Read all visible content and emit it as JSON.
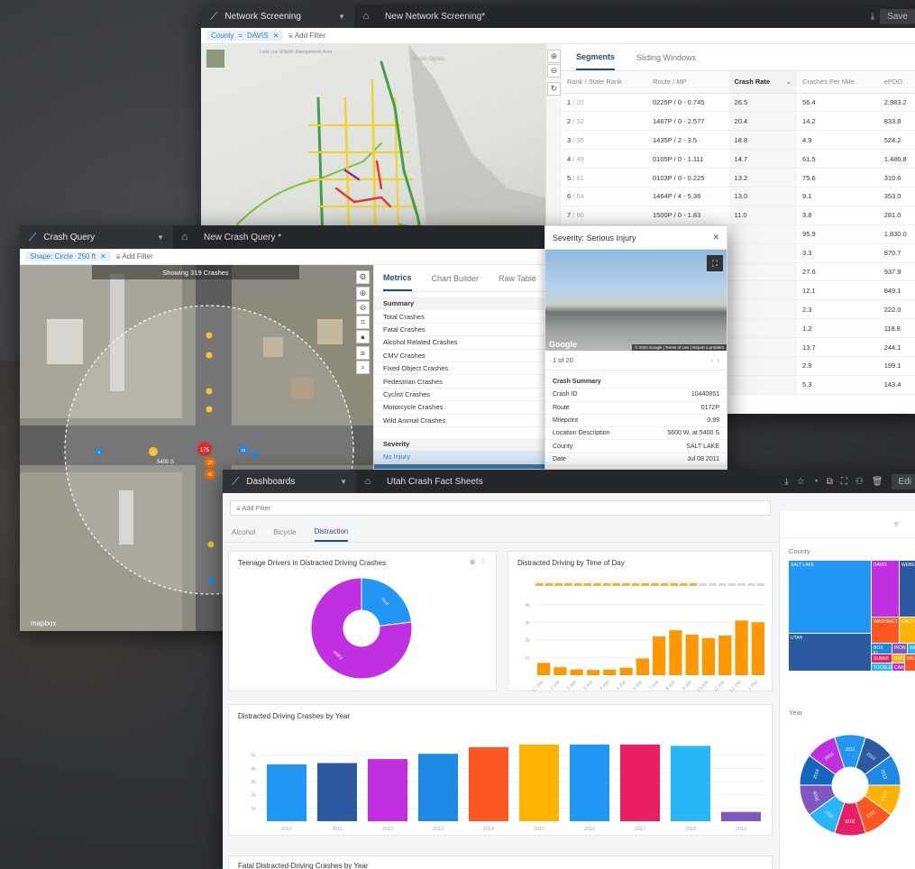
{
  "network": {
    "app_title": "Network Screening",
    "doc_title": "New Network Screening*",
    "save_label": "Save",
    "filter_chip_key": "County",
    "filter_chip_value": "DAVIS",
    "add_filter": "Add Filter",
    "map_labels": [
      "Lake Lee Wildlife Management Area",
      "South Ogden"
    ],
    "tabs": [
      "Segments",
      "Sliding Windows"
    ],
    "columns": [
      "Rank / State Rank",
      "Route / MP",
      "Crash Rate",
      "Crashes Per Mile",
      "ePDO"
    ],
    "rows": [
      {
        "rank": "1",
        "state": "20",
        "route": "0225P / 0 - 0.745",
        "rate": "26.5",
        "cpm": "56.4",
        "epdo": "2,983.2"
      },
      {
        "rank": "2",
        "state": "32",
        "route": "1467P / 0 - 2.577",
        "rate": "20.4",
        "cpm": "14.2",
        "epdo": "833.8"
      },
      {
        "rank": "3",
        "state": "36",
        "route": "1435P / 2 - 3.5",
        "rate": "18.8",
        "cpm": "4.9",
        "epdo": "524.2"
      },
      {
        "rank": "4",
        "state": "49",
        "route": "0105P / 0 - 1.111",
        "rate": "14.7",
        "cpm": "61.5",
        "epdo": "1,486.8"
      },
      {
        "rank": "5",
        "state": "61",
        "route": "0103P / 0 - 0.225",
        "rate": "13.2",
        "cpm": "75.6",
        "epdo": "310.6"
      },
      {
        "rank": "6",
        "state": "64",
        "route": "1464P / 4 - 5.36",
        "rate": "13.0",
        "cpm": "9.1",
        "epdo": "353.0"
      },
      {
        "rank": "7",
        "state": "80",
        "route": "1500P / 0 - 1.83",
        "rate": "11.0",
        "cpm": "3.8",
        "epdo": "281.0"
      },
      {
        "rank": "",
        "state": "",
        "route": "",
        "rate": "",
        "cpm": "95.9",
        "epdo": "1,830.0"
      },
      {
        "rank": "",
        "state": "",
        "route": "",
        "rate": "",
        "cpm": "3.3",
        "epdo": "870.7"
      },
      {
        "rank": "",
        "state": "",
        "route": "",
        "rate": "",
        "cpm": "27.6",
        "epdo": "937.9"
      },
      {
        "rank": "",
        "state": "",
        "route": "",
        "rate": "",
        "cpm": "12.1",
        "epdo": "849.1"
      },
      {
        "rank": "",
        "state": "",
        "route": "",
        "rate": "",
        "cpm": "2.3",
        "epdo": "222.0"
      },
      {
        "rank": "",
        "state": "",
        "route": "",
        "rate": "",
        "cpm": "1.2",
        "epdo": "118.8"
      },
      {
        "rank": "",
        "state": "",
        "route": "",
        "rate": "",
        "cpm": "13.7",
        "epdo": "244.1"
      },
      {
        "rank": "",
        "state": "",
        "route": "",
        "rate": "",
        "cpm": "2.9",
        "epdo": "199.1"
      },
      {
        "rank": "",
        "state": "",
        "route": "",
        "rate": "",
        "cpm": "5.3",
        "epdo": "143.4"
      }
    ]
  },
  "crash": {
    "app_title": "Crash Query",
    "doc_title": "New Crash Query *",
    "shape_chip": "Shape: Circle",
    "radius_chip": "250 ft",
    "add_filter": "Add Filter",
    "showing": "Showing 319 Crashes",
    "street_label": "5400 S",
    "mapbox": "mapbox",
    "tabs": [
      "Metrics",
      "Chart Builder",
      "Raw Table"
    ],
    "summary_header": "Summary",
    "metrics": [
      "Total Crashes",
      "Fatal Crashes",
      "Alcohol Related Crashes",
      "CMV Crashes",
      "Fixed Object Crashes",
      "Pedestrian Crashes",
      "Cyclist Crashes",
      "Motorcycle Crashes",
      "Wild Animal Crashes"
    ],
    "severity_header": "Severity",
    "severity_first": "No Injury",
    "markers": [
      "175",
      "20",
      "46",
      "15",
      "6",
      "5"
    ],
    "popup": {
      "title": "Severity: Serious Injury",
      "google": "Google",
      "attribution": "© 2020 Google | Terms of Use | Report a problem",
      "pager": "1 of 20",
      "section": "Crash Summary",
      "fields": [
        {
          "k": "Crash ID",
          "v": "10440851"
        },
        {
          "k": "Route",
          "v": "0172P"
        },
        {
          "k": "Milepoint",
          "v": "0.99"
        },
        {
          "k": "Location Description",
          "v": "5600 W, at 5400 S"
        },
        {
          "k": "County",
          "v": "SALT LAKE"
        },
        {
          "k": "Date",
          "v": "Jul 08 2011"
        }
      ]
    }
  },
  "dash": {
    "app_title": "Dashboards",
    "doc_title": "Utah Crash Fact Sheets",
    "edit_label": "Edi",
    "add_filter": "Add Filter",
    "tabs": [
      "Alcohol",
      "Bicycle",
      "Distraction"
    ],
    "card1_title": "Teenage Drivers in Distracted Driving Crashes",
    "card2_title": "Distracted Driving by Time of Day",
    "card3_title": "Distracted Driving Crashes by Year",
    "card4_title": "Fatal Distracted-Driving Crashes by Year",
    "county_label": "County",
    "year_label": "Year",
    "tree_labels": [
      "SALT LAKE",
      "DAVIS",
      "WEBE",
      "WASHINGT",
      "CACH",
      "UTAH",
      "BOX EL",
      "IRON",
      "WA",
      "SUMMI",
      "DUCH",
      "TOOELE",
      "CARB",
      "MILL"
    ]
  },
  "chart_data": [
    {
      "type": "pie",
      "title": "Teenage Drivers in Distracted Driving Crashes",
      "labels": [
        "True",
        "False"
      ],
      "values": [
        23,
        77
      ],
      "colors": [
        "#2196f3",
        "#c02fe0"
      ]
    },
    {
      "type": "bar",
      "title": "Distracted Driving by Time of Day",
      "categories": [
        "12 AM",
        "2 AM",
        "4 AM",
        "6 AM",
        "8 AM",
        "10 AM",
        "12 PM",
        "2 PM",
        "4 PM",
        "6 PM",
        "8 PM",
        "10 PM"
      ],
      "x_labels": [
        "12 AM",
        "1 AM",
        "2 AM",
        "3 AM",
        "4 AM",
        "5 AM",
        "6 AM",
        "7 AM",
        "8 AM",
        "9 AM",
        "10 AM",
        "11 AM",
        "12 PM",
        "1 PM"
      ],
      "values": [
        700,
        450,
        330,
        300,
        320,
        420,
        950,
        2200,
        2550,
        2300,
        2100,
        2250,
        3100,
        3000
      ],
      "yticks": [
        "1k",
        "2k",
        "3k",
        "4k"
      ],
      "ylim": [
        0,
        4500
      ],
      "color": "#ff9800"
    },
    {
      "type": "bar",
      "title": "Distracted Driving Crashes by Year",
      "categories": [
        "2010",
        "2011",
        "2012",
        "2013",
        "2014",
        "2015",
        "2016",
        "2017",
        "2018",
        "2019"
      ],
      "values": [
        4300,
        4400,
        4700,
        5100,
        5600,
        5800,
        5800,
        5800,
        5700,
        700
      ],
      "colors": [
        "#2196f3",
        "#2c5aa0",
        "#c02fe0",
        "#1e88e5",
        "#ff5722",
        "#ffb300",
        "#2196f3",
        "#e91e63",
        "#29b6f6",
        "#7e57c2"
      ],
      "yticks": [
        "1k",
        "2k",
        "3k",
        "4k",
        "5k"
      ],
      "ylim": [
        0,
        6000
      ]
    },
    {
      "type": "pie",
      "title": "Year",
      "labels": [
        "2010",
        "2011",
        "2012",
        "2013",
        "2014",
        "2015",
        "2016",
        "2017",
        "2018",
        "2019"
      ],
      "values": [
        10,
        10,
        10,
        10,
        10,
        10,
        10,
        10,
        10,
        10
      ],
      "colors": [
        "#c02fe0",
        "#2196f3",
        "#2c5aa0",
        "#1e88e5",
        "#ffb300",
        "#ff5722",
        "#e91e63",
        "#29b6f6",
        "#7e57c2",
        "#1565c0"
      ]
    }
  ]
}
